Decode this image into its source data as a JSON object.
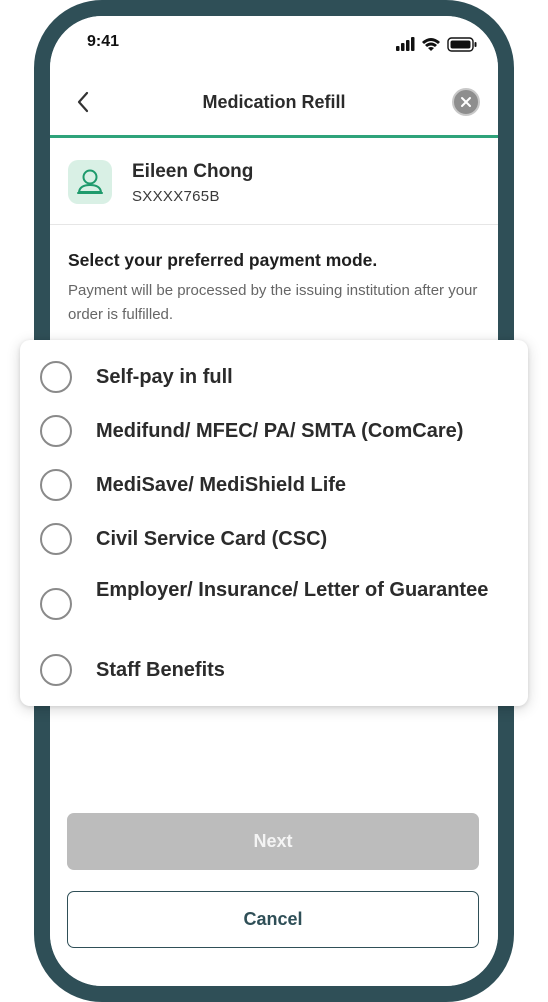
{
  "status_bar": {
    "time": "9:41",
    "icons": [
      "signal-icon",
      "wifi-icon",
      "battery-icon"
    ]
  },
  "nav": {
    "title": "Medication Refill",
    "back_icon": "chevron-left-icon",
    "close_icon": "close-icon"
  },
  "profile": {
    "name": "Eileen Chong",
    "id": "SXXXX765B",
    "avatar_icon": "person-icon"
  },
  "payment": {
    "title": "Select your preferred payment mode.",
    "description": "Payment will be processed by the issuing institution after your order is fulfilled.",
    "options": [
      {
        "label": "Self-pay in full",
        "selected": false
      },
      {
        "label": "Medifund/ MFEC/ PA/ SMTA (ComCare)",
        "selected": false
      },
      {
        "label": "MediSave/ MediShield Life",
        "selected": false
      },
      {
        "label": "Civil Service Card (CSC)",
        "selected": false
      },
      {
        "label": "Employer/ Insurance/ Letter of Guarantee",
        "selected": false
      },
      {
        "label": "Staff Benefits",
        "selected": false
      }
    ]
  },
  "actions": {
    "next_label": "Next",
    "next_enabled": false,
    "cancel_label": "Cancel"
  },
  "colors": {
    "frame": "#2f4f57",
    "accent_green": "#2fa37a",
    "avatar_bg": "#d9f0e5",
    "disabled_button": "#bcbcbc"
  }
}
